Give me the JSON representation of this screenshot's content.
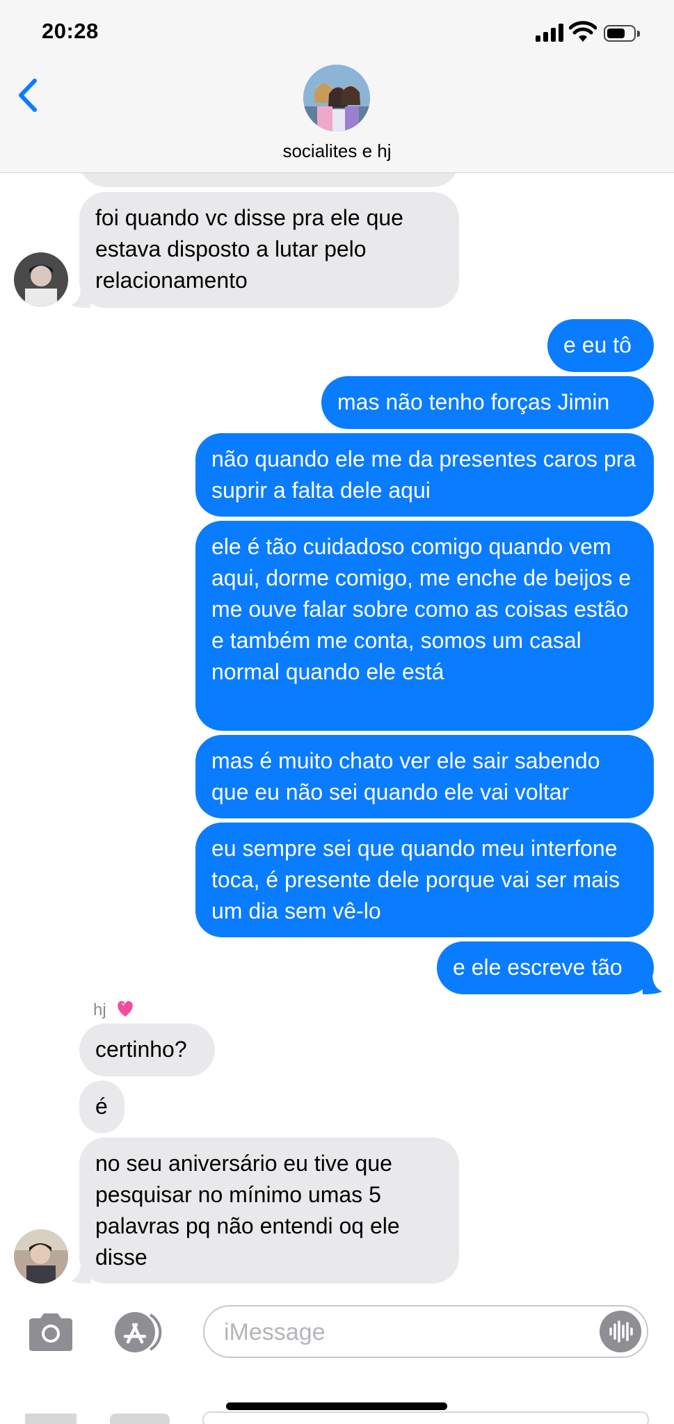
{
  "status_bar": {
    "time": "20:28"
  },
  "header": {
    "group_name": "socialites e hj"
  },
  "thread": {
    "sender_label": "hj",
    "messages": [
      {
        "dir": "in",
        "text": "foi quando vc disse pra ele que estava disposto a lutar pelo relacionamento"
      },
      {
        "dir": "out",
        "text": "e eu tô"
      },
      {
        "dir": "out",
        "text": "mas não tenho forças Jimin"
      },
      {
        "dir": "out",
        "text": "não quando ele me da presentes caros pra suprir a falta dele aqui"
      },
      {
        "dir": "out",
        "text": "ele é tão cuidadoso comigo quando vem aqui, dorme comigo, me enche de beijos e me ouve falar sobre como as coisas estão e também me conta, somos um casal normal quando ele está"
      },
      {
        "dir": "out",
        "text": "mas é muito chato ver ele sair sabendo que eu não sei quando ele vai voltar"
      },
      {
        "dir": "out",
        "text": "eu sempre sei que quando meu interfone toca, é presente dele porque vai ser mais um dia sem vê-lo"
      },
      {
        "dir": "out",
        "text": "e ele escreve tão"
      },
      {
        "dir": "in",
        "text": "certinho?"
      },
      {
        "dir": "in",
        "text": "é"
      },
      {
        "dir": "in",
        "text": "no seu aniversário eu tive que pesquisar no mínimo umas 5 palavras pq não entendi oq ele disse"
      }
    ]
  },
  "input": {
    "placeholder": "iMessage"
  },
  "icons": {
    "back": "chevron-left-icon",
    "camera": "camera-icon",
    "apps": "app-store-icon",
    "audio": "waveform-icon",
    "heart": "sparkling-heart-emoji"
  },
  "colors": {
    "outgoing": "#0a7cff",
    "incoming": "#e9e9eb",
    "accent": "#0a7cff"
  }
}
